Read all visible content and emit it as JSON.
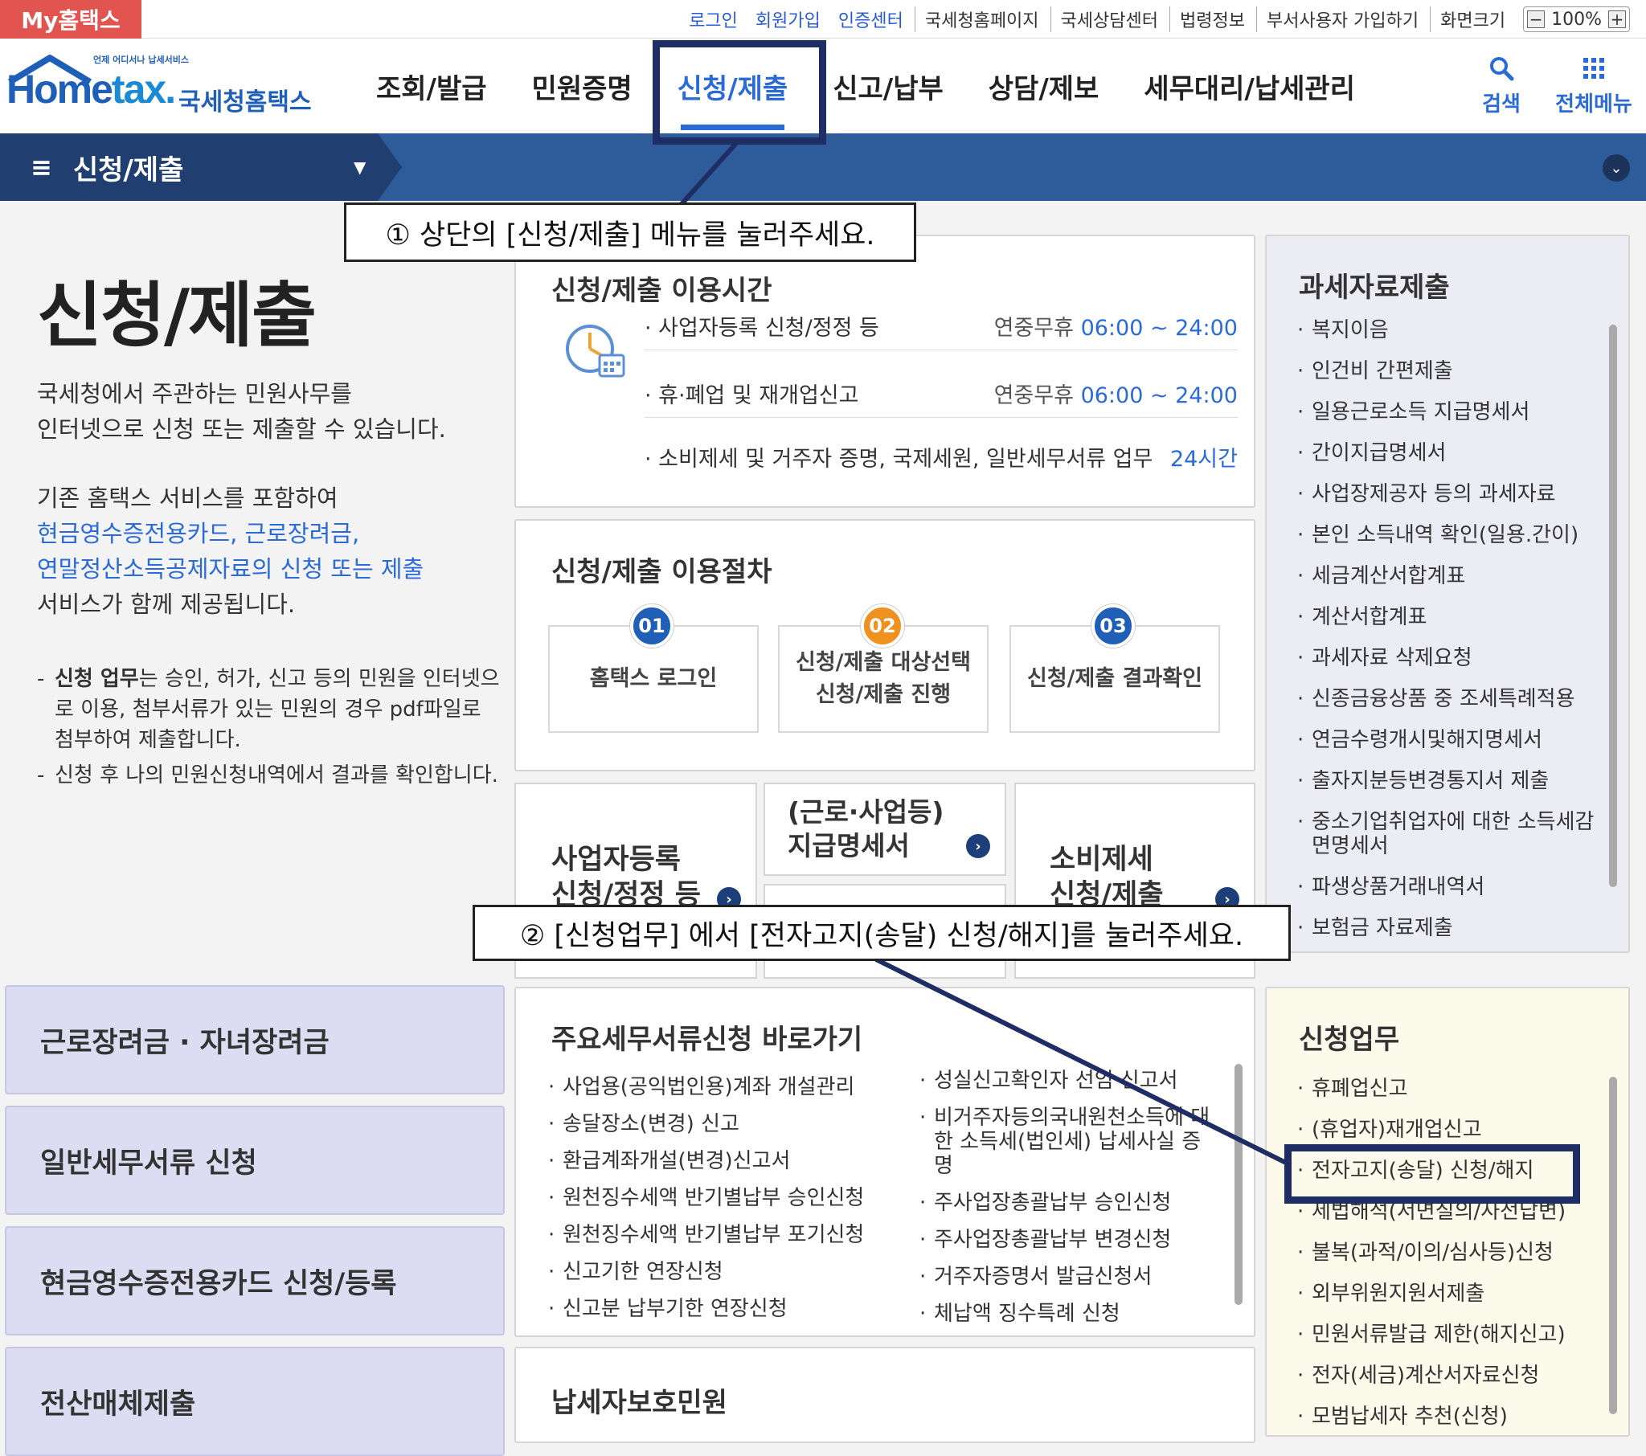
{
  "topbar": {
    "my_hometax": "My홈택스",
    "links_blue": [
      "로그인",
      "회원가입",
      "인증센터"
    ],
    "links_gray": [
      "국세청홈페이지",
      "국세상담센터",
      "법령정보",
      "부서사용자 가입하기"
    ],
    "screen_size_label": "화면크기",
    "zoom_minus": "−",
    "zoom_value": "100%",
    "zoom_plus": "+"
  },
  "header": {
    "logo_small": "언제 어디서나 납세서비스",
    "logo_big_a": "Home",
    "logo_big_b": "tax.",
    "logo_kr": "국세청홈택스",
    "menu": [
      "조회/발급",
      "민원증명",
      "신청/제출",
      "신고/납부",
      "상담/제보",
      "세무대리/납세관리"
    ],
    "active_menu": "신청/제출",
    "search_label": "검색",
    "allmenu_label": "전체메뉴"
  },
  "navbar": {
    "title": "신청/제출"
  },
  "left": {
    "page_title": "신청/제출",
    "intro1_line1": "국세청에서 주관하는 민원사무를",
    "intro1_line2": "인터넷으로 신청 또는 제출할 수 있습니다.",
    "intro2_line1": "기존 홈택스 서비스를 포함하여",
    "intro2_blue1": "현금영수증전용카드, 근로장려금,",
    "intro2_blue2": "연말정산소득공제자료의 신청 또는 제출",
    "intro2_line4": "서비스가 함께 제공됩니다.",
    "bullet1_bold": "신청 업무",
    "bullet1_rest": "는 승인, 허가, 신고 등의 민원을 인터넷으로 이용, 첨부서류가 있는 민원의 경우 pdf파일로 첨부하여 제출합니다.",
    "bullet2": "신청 후 나의 민원신청내역에서 결과를 확인합니다.",
    "buttons": [
      "근로장려금 · 자녀장려금",
      "일반세무서류 신청",
      "현금영수증전용카드 신청/등록",
      "전산매체제출"
    ]
  },
  "hours": {
    "title": "신청/제출 이용시간",
    "rows": [
      {
        "label": "사업자등록 신청/정정 등",
        "prefix": "연중무휴 ",
        "time": "06:00 ~ 24:00"
      },
      {
        "label": "휴·폐업 및 재개업신고",
        "prefix": "연중무휴 ",
        "time": "06:00 ~ 24:00"
      },
      {
        "label": "소비제세 및 거주자 증명, 국제세원, 일반세무서류 업무",
        "prefix": "",
        "time": "24시간"
      }
    ]
  },
  "procedure": {
    "title": "신청/제출 이용절차",
    "steps": [
      {
        "num": "01",
        "line1": "홈택스 로그인",
        "line2": "",
        "color": "#1f5fb8"
      },
      {
        "num": "02",
        "line1": "신청/제출 대상선택",
        "line2": "신청/제출 진행",
        "color": "#f0901e"
      },
      {
        "num": "03",
        "line1": "신청/제출 결과확인",
        "line2": "",
        "color": "#1f5fb8"
      }
    ]
  },
  "quick": {
    "biz_line1": "사업자등록",
    "biz_line2": "신청/정정 등",
    "payment_line1": "(근로·사업등)",
    "payment_line2": "지급명세서",
    "excise_line1": "소비제세",
    "excise_line2": "신청/제출"
  },
  "major_docs": {
    "title": "주요세무서류신청 바로가기",
    "col1": [
      "사업용(공익법인용)계좌 개설관리",
      "송달장소(변경) 신고",
      "환급계좌개설(변경)신고서",
      "원천징수세액 반기별납부 승인신청",
      "원천징수세액 반기별납부 포기신청",
      "신고기한 연장신청",
      "신고분 납부기한 연장신청"
    ],
    "col2": [
      "성실신고확인자 선임 신고서",
      "비거주자등의국내원천소득에 대한 소득세(법인세) 납세사실 증명",
      "주사업장총괄납부 승인신청",
      "주사업장총괄납부 변경신청",
      "거주자증명서 발급신청서",
      "체납액 징수특례 신청"
    ]
  },
  "protection": {
    "title": "납세자보호민원"
  },
  "tax_data": {
    "title": "과세자료제출",
    "items": [
      "복지이음",
      "인건비 간편제출",
      "일용근로소득 지급명세서",
      "간이지급명세서",
      "사업장제공자 등의 과세자료",
      "본인 소득내역 확인(일용.간이)",
      "세금계산서합계표",
      "계산서합계표",
      "과세자료 삭제요청",
      "신종금융상품 중 조세특례적용",
      "연금수령개시및해지명세서",
      "출자지분등변경통지서 제출",
      "중소기업취업자에 대한 소득세감면명세서",
      "파생상품거래내역서",
      "보험금 자료제출"
    ]
  },
  "apply_work": {
    "title": "신청업무",
    "items": [
      "휴폐업신고",
      "(휴업자)재개업신고",
      "전자고지(송달) 신청/해지",
      "세법해석(서면질의/사전답변)",
      "불복(과적/이의/심사등)신청",
      "외부위원지원서제출",
      "민원서류발급 제한(해지신고)",
      "전자(세금)계산서자료신청",
      "모범납세자 추천(신청)"
    ]
  },
  "annotations": {
    "step1": "① 상단의 [신청/제출] 메뉴를 눌러주세요.",
    "step2": "② [신청업무] 에서 [전자고지(송달) 신청/해지]를 눌러주세요."
  },
  "colors": {
    "accent": "#2a6bd8",
    "navbar": "#2e5b9a",
    "highlight_border": "#1e2d63",
    "left_button_bg": "#dcdcf2",
    "apply_panel_bg": "#fcfaea",
    "tax_panel_bg": "#ececf5"
  }
}
